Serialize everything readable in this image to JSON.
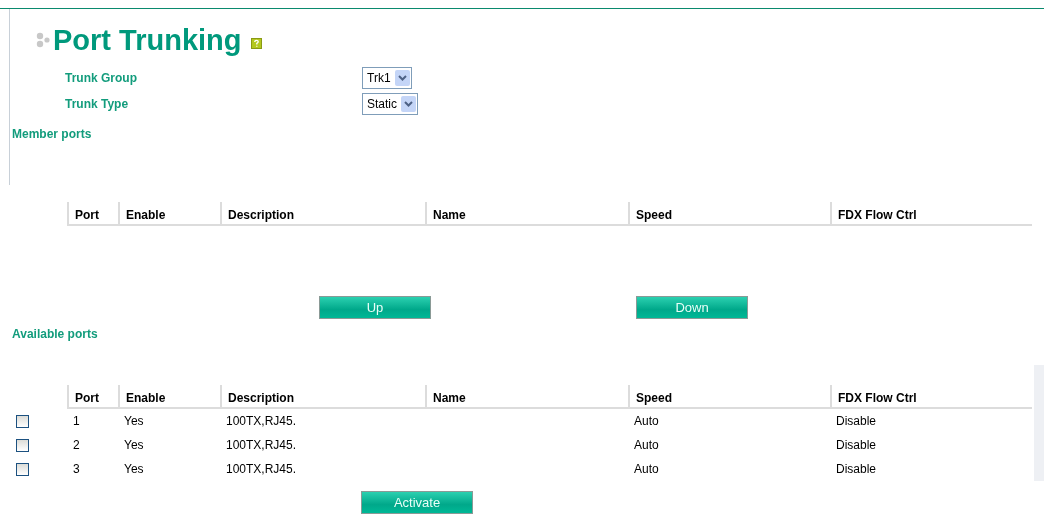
{
  "page": {
    "title": "Port Trunking"
  },
  "form": [
    {
      "label": "Trunk Group",
      "value": "Trk1"
    },
    {
      "label": "Trunk Type",
      "value": "Static"
    }
  ],
  "member_ports": {
    "heading": "Member ports",
    "columns": [
      "Port",
      "Enable",
      "Description",
      "Name",
      "Speed",
      "FDX Flow Ctrl"
    ]
  },
  "move_buttons": [
    "Up",
    "Down"
  ],
  "available_ports": {
    "heading": "Available ports",
    "columns": [
      "Port",
      "Enable",
      "Description",
      "Name",
      "Speed",
      "FDX Flow Ctrl"
    ],
    "rows": [
      {
        "checked": false,
        "cells": [
          "1",
          "Yes",
          "100TX,RJ45.",
          "",
          "Auto",
          "Disable"
        ]
      },
      {
        "checked": false,
        "cells": [
          "2",
          "Yes",
          "100TX,RJ45.",
          "",
          "Auto",
          "Disable"
        ]
      },
      {
        "checked": false,
        "cells": [
          "3",
          "Yes",
          "100TX,RJ45.",
          "",
          "Auto",
          "Disable"
        ]
      }
    ]
  },
  "activate_button": "Activate"
}
